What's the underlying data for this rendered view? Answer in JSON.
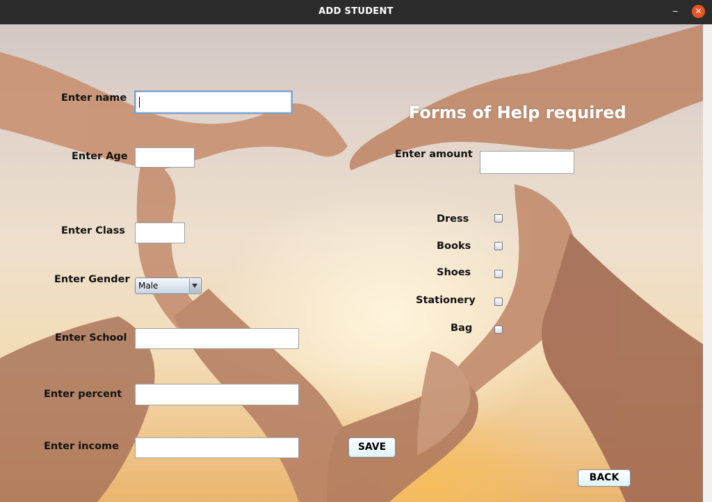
{
  "window": {
    "title": "ADD STUDENT",
    "minimize_glyph": "–",
    "close_glyph": "✕",
    "close_color": "#e95420"
  },
  "form": {
    "name": {
      "label": "Enter name",
      "value": ""
    },
    "age": {
      "label": "Enter Age",
      "value": ""
    },
    "class": {
      "label": "Enter Class",
      "value": ""
    },
    "gender": {
      "label": "Enter Gender",
      "selected": "Male"
    },
    "school": {
      "label": "Enter School",
      "value": ""
    },
    "percent": {
      "label": "Enter percent",
      "value": ""
    },
    "income": {
      "label": "Enter income",
      "value": ""
    }
  },
  "help": {
    "heading": "Forms of Help required",
    "amount": {
      "label": "Enter amount",
      "value": ""
    },
    "items": [
      {
        "label": "Dress",
        "checked": false
      },
      {
        "label": "Books",
        "checked": false
      },
      {
        "label": "Shoes",
        "checked": false
      },
      {
        "label": "Stationery",
        "checked": false
      },
      {
        "label": "Bag",
        "checked": false
      }
    ]
  },
  "buttons": {
    "save": "SAVE",
    "back": "BACK"
  },
  "background": {
    "description_icon": "heart-hands-image",
    "accent": "#f3dcb6"
  }
}
